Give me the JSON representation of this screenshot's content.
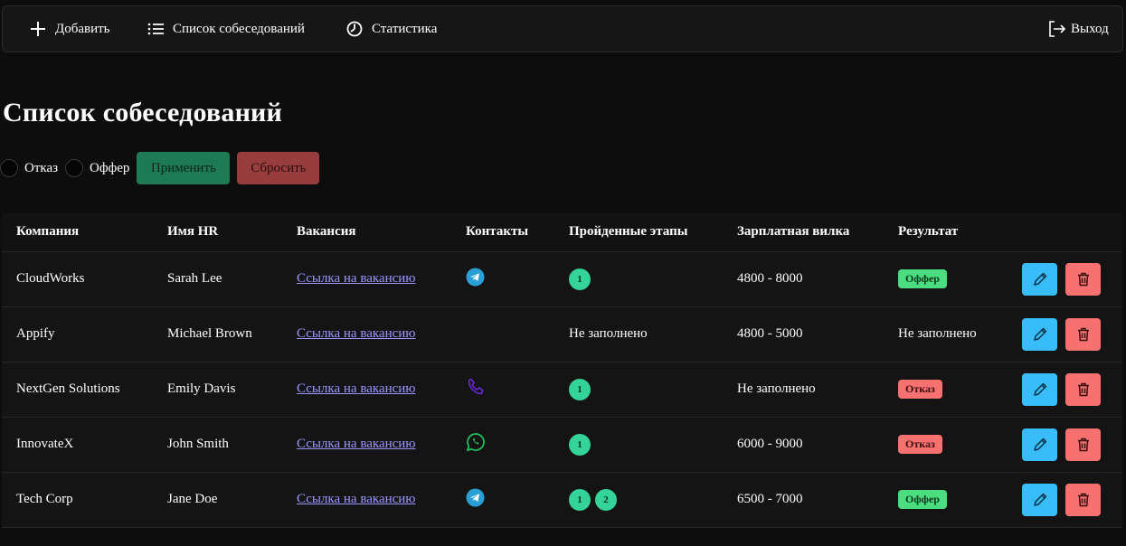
{
  "nav": {
    "add": "Добавить",
    "list": "Список собеседований",
    "stats": "Статистика",
    "logout": "Выход"
  },
  "page": {
    "title": "Список собеседований"
  },
  "filters": {
    "reject_label": "Отказ",
    "offer_label": "Оффер",
    "apply": "Применить",
    "reset": "Сбросить"
  },
  "table": {
    "headers": [
      "Компания",
      "Имя HR",
      "Вакансия",
      "Контакты",
      "Пройденные этапы",
      "Зарплатная вилка",
      "Результат"
    ],
    "rows": [
      {
        "company": "CloudWorks",
        "hr": "Sarah Lee",
        "vacancy": "Ссылка на вакансию",
        "contact": "telegram-icon",
        "stages": [
          "1"
        ],
        "stages_text": "",
        "salary": "4800 - 8000",
        "result": "Оффер",
        "result_type": "offer"
      },
      {
        "company": "Appify",
        "hr": "Michael Brown",
        "vacancy": "Ссылка на вакансию",
        "contact": "",
        "stages": [],
        "stages_text": "Не заполнено",
        "salary": "4800 - 5000",
        "result": "Не заполнено",
        "result_type": "text"
      },
      {
        "company": "NextGen Solutions",
        "hr": "Emily Davis",
        "vacancy": "Ссылка на вакансию",
        "contact": "phone-icon",
        "stages": [
          "1"
        ],
        "stages_text": "",
        "salary": "Не заполнено",
        "result": "Отказ",
        "result_type": "reject"
      },
      {
        "company": "InnovateX",
        "hr": "John Smith",
        "vacancy": "Ссылка на вакансию",
        "contact": "whatsapp-icon",
        "stages": [
          "1"
        ],
        "stages_text": "",
        "salary": "6000 - 9000",
        "result": "Отказ",
        "result_type": "reject"
      },
      {
        "company": "Tech Corp",
        "hr": "Jane Doe",
        "vacancy": "Ссылка на вакансию",
        "contact": "telegram-icon",
        "stages": [
          "1",
          "2"
        ],
        "stages_text": "",
        "salary": "6500 - 7000",
        "result": "Оффер",
        "result_type": "offer"
      }
    ]
  },
  "colors": {
    "background": "#0d0d0d",
    "link": "#9b97ff",
    "stage": "#34d399",
    "offer": "#4ade80",
    "reject": "#f87171",
    "edit": "#38bdf8",
    "delete": "#f87171",
    "apply": "#1e7a52",
    "reset": "#973d3d"
  }
}
